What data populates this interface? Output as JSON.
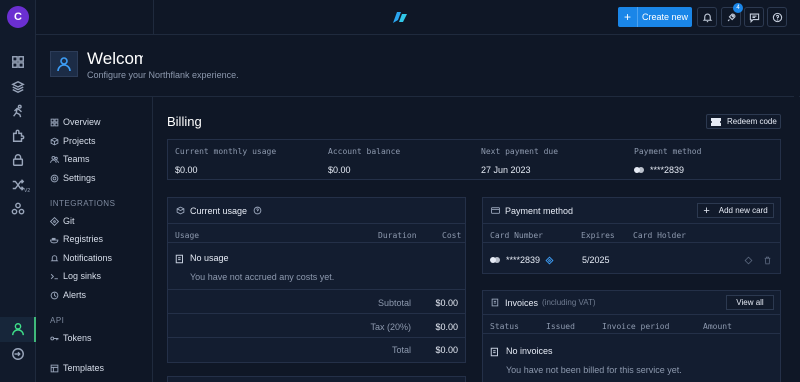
{
  "user": {
    "initial": "C"
  },
  "header": {
    "create_label": "Create new",
    "notifications_badge": "4"
  },
  "welcome": {
    "title": "Welcome",
    "subtitle": "Configure your Northflank experience."
  },
  "rail": {
    "v2_label": "V2"
  },
  "nav": {
    "main": [
      "Overview",
      "Projects",
      "Teams",
      "Settings"
    ],
    "integrations_header": "INTEGRATIONS",
    "integrations": [
      "Git",
      "Registries",
      "Notifications",
      "Log sinks",
      "Alerts"
    ],
    "api_header": "API",
    "api": [
      "Tokens"
    ],
    "templates": "Templates"
  },
  "billing": {
    "title": "Billing",
    "redeem_label": "Redeem code",
    "summary": {
      "usage_label": "Current monthly usage",
      "usage_value": "$0.00",
      "balance_label": "Account balance",
      "balance_value": "$0.00",
      "next_payment_label": "Next payment due",
      "next_payment_value": "27 Jun 2023",
      "method_label": "Payment method",
      "method_value": "****2839"
    },
    "current_usage": {
      "title": "Current usage",
      "col_usage": "Usage",
      "col_duration": "Duration",
      "col_cost": "Cost",
      "empty_title": "No usage",
      "empty_desc": "You have not accrued any costs yet.",
      "subtotal_label": "Subtotal",
      "subtotal_value": "$0.00",
      "tax_label": "Tax (20%)",
      "tax_value": "$0.00",
      "total_label": "Total",
      "total_value": "$0.00"
    },
    "payment_method": {
      "title": "Payment method",
      "add_label": "Add new card",
      "col_number": "Card Number",
      "col_expires": "Expires",
      "col_holder": "Card Holder",
      "card_number": "****2839",
      "card_expires": "5/2025",
      "card_holder": ""
    },
    "invoices": {
      "title": "Invoices",
      "note": "(including VAT)",
      "view_all_label": "View all",
      "col_status": "Status",
      "col_issued": "Issued",
      "col_period": "Invoice period",
      "col_amount": "Amount",
      "empty_title": "No invoices",
      "empty_desc": "You have not been billed for this service yet."
    }
  },
  "colors": {
    "accent": "#1a86e8",
    "active": "#3fe08a",
    "avatar": "#6b2fd1"
  }
}
